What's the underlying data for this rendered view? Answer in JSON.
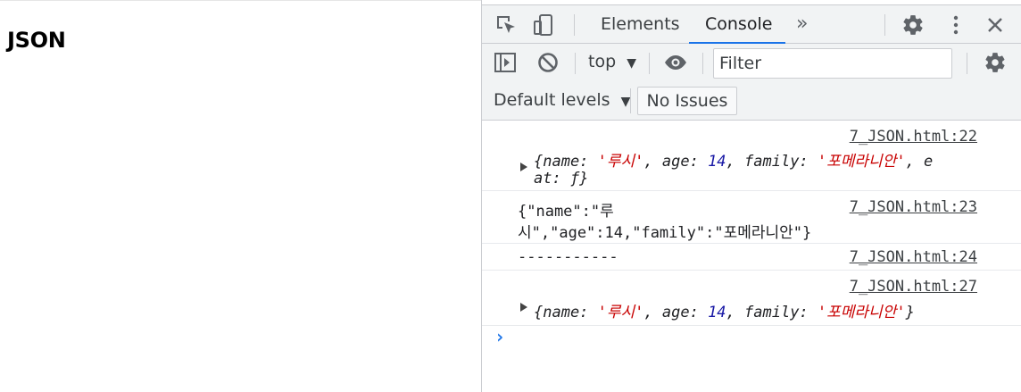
{
  "page": {
    "heading": "JSON"
  },
  "devtools": {
    "tabs": [
      "Elements",
      "Console",
      "»"
    ],
    "context": "top",
    "filter_placeholder": "Filter",
    "levels_label": "Default levels",
    "issues_label": "No Issues",
    "accent_color": "#1a73e8"
  },
  "console": {
    "messages": [
      {
        "source": "7_JSON.html:22",
        "line1_prefix": "{name: ",
        "line1_name": "'루시'",
        "line1_mid": ", age: ",
        "line1_age": "14",
        "line1_mid2": ", family: ",
        "line1_family": "'포메라니안'",
        "line1_tail": ", e",
        "line2": "at: ƒ}"
      },
      {
        "source": "7_JSON.html:23",
        "line1": "{\"name\":\"루",
        "line2": "시\",\"age\":14,\"family\":\"포메라니안\"}"
      },
      {
        "source": "7_JSON.html:24",
        "line1": "-----------"
      },
      {
        "source": "7_JSON.html:27",
        "prefix": "{name: ",
        "name": "'루시'",
        "mid": ", age: ",
        "age": "14",
        "mid2": ", family: ",
        "family": "'포메라니안'",
        "tail": "}"
      }
    ],
    "prompt": "›"
  }
}
